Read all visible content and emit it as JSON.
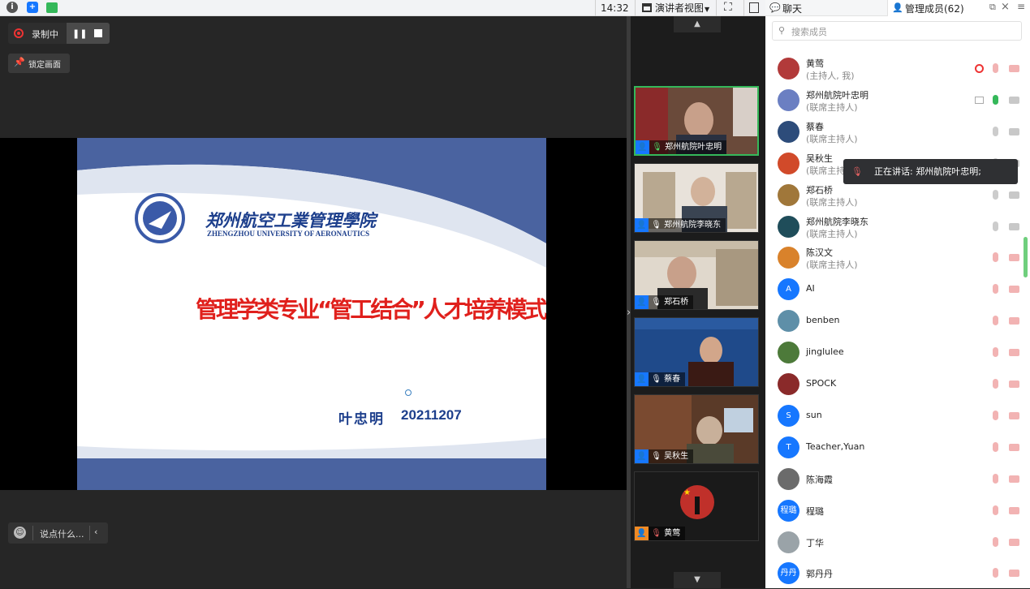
{
  "topbar": {
    "time": "14:32",
    "view_label": "演讲者视图"
  },
  "stage": {
    "recording_label": "录制中",
    "pin_label": "锁定画面",
    "chat_placeholder": "说点什么...",
    "slide": {
      "school_name_cn": "郑州航空工業管理學院",
      "school_name_en": "ZHENGZHOU UNIVERSITY OF AERONAUTICS",
      "title": "管理学类专业“管工结合”人才培养模式",
      "presenter": "叶忠明",
      "date": "20211207"
    }
  },
  "thumbnails": [
    {
      "name": "郑州航院叶忠明",
      "active": true
    },
    {
      "name": "郑州航院李晓东",
      "active": false
    },
    {
      "name": "郑石桥",
      "active": false
    },
    {
      "name": "蔡春",
      "active": false
    },
    {
      "name": "吴秋生",
      "active": false
    },
    {
      "name": "黄莺",
      "active": false
    }
  ],
  "panel": {
    "tab_chat": "聊天",
    "tab_members": "管理成员(62)",
    "search_placeholder": "搜索成员",
    "speaking_tooltip": "正在讲话: 郑州航院叶忠明;",
    "members": [
      {
        "name": "黄莺",
        "role": "(主持人, 我)",
        "avatar": "",
        "color": "#b23a3a"
      },
      {
        "name": "郑州航院叶忠明",
        "role": "(联席主持人)",
        "avatar": "",
        "color": "#6b7fc2"
      },
      {
        "name": "蔡春",
        "role": "(联席主持人)",
        "avatar": "",
        "color": "#2d4c7a"
      },
      {
        "name": "吴秋生",
        "role": "(联席主持人)",
        "avatar": "",
        "color": "#d14a2a"
      },
      {
        "name": "郑石桥",
        "role": "(联席主持人)",
        "avatar": "",
        "color": "#a0773a"
      },
      {
        "name": "郑州航院李晓东",
        "role": "(联席主持人)",
        "avatar": "",
        "color": "#1f4d5a"
      },
      {
        "name": "陈汉文",
        "role": "(联席主持人)",
        "avatar": "",
        "color": "#d9822b"
      },
      {
        "name": "AI",
        "role": "",
        "avatar": "A",
        "color": "#1677ff"
      },
      {
        "name": "benben",
        "role": "",
        "avatar": "",
        "color": "#5e8fa8"
      },
      {
        "name": "jinglulee",
        "role": "",
        "avatar": "",
        "color": "#4d7a3a"
      },
      {
        "name": "SPOCK",
        "role": "",
        "avatar": "",
        "color": "#8a2a2a"
      },
      {
        "name": "sun",
        "role": "",
        "avatar": "S",
        "color": "#1677ff"
      },
      {
        "name": "Teacher,Yuan",
        "role": "",
        "avatar": "T",
        "color": "#1677ff"
      },
      {
        "name": "陈海霞",
        "role": "",
        "avatar": "",
        "color": "#6b6b6b"
      },
      {
        "name": "程璐",
        "role": "",
        "avatar": "程璐",
        "color": "#1677ff"
      },
      {
        "name": "丁华",
        "role": "",
        "avatar": "",
        "color": "#9aa3a8"
      },
      {
        "name": "郭丹丹",
        "role": "",
        "avatar": "丹丹",
        "color": "#1677ff"
      }
    ]
  },
  "colors": {
    "accent": "#1677ff",
    "muted_red": "#e06060",
    "active_green": "#35b85a",
    "slide_blue": "#4a63a0",
    "title_red": "#e0201c"
  }
}
